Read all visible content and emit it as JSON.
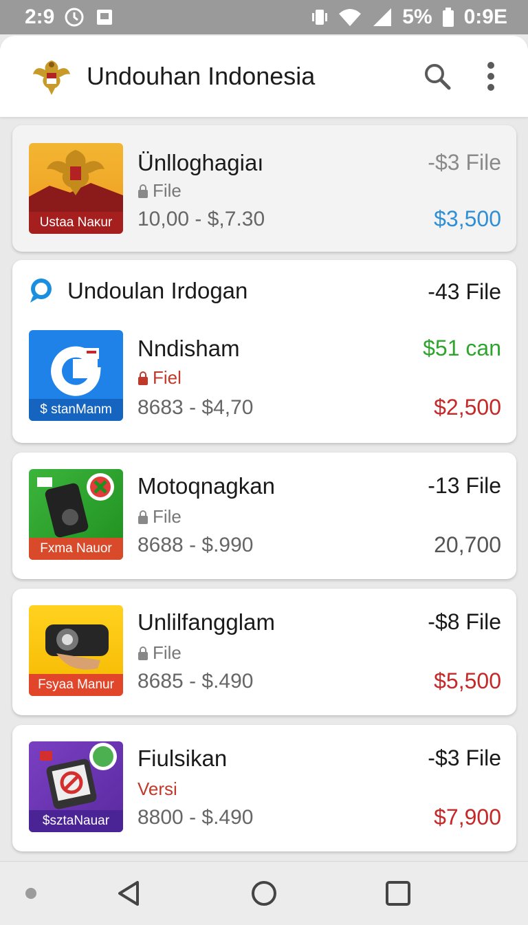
{
  "status_bar": {
    "time": "2:9",
    "battery": "5%",
    "clock_right": "0:9E"
  },
  "app_bar": {
    "title": "Undouhan Indonesia",
    "icons": [
      "garuda-logo",
      "search-icon",
      "more-vert-icon"
    ]
  },
  "items": [
    {
      "name": "Ünlloghagiaı",
      "sub": "File",
      "range": "10,00 - $,7.30",
      "count": "-$3 File",
      "price": "$3,500",
      "thumb_label": "Ustaa Naĸur",
      "price_color": "#2e8fd6"
    }
  ],
  "section": {
    "title": "Undoulan Irdogan",
    "count": "-43 File",
    "item": {
      "name": "Nndisham",
      "sub": "Fiel",
      "range": "8683 - $4,70",
      "price_top": "$51 can",
      "price": "$2,500",
      "thumb_label": "$ stanManm"
    }
  },
  "more_items": [
    {
      "name": "Motoqnagkan",
      "sub": "File",
      "range": "8688 - $.990",
      "count": "-13 File",
      "price": "20,700",
      "thumb_label": "Fxma Nauor"
    },
    {
      "name": "Unlilfangglam",
      "sub": "File",
      "range": "8685 - $.490",
      "count": "-$8 File",
      "price": "$5,500",
      "thumb_label": "Fsyaa Manur"
    },
    {
      "name": "Fiulsikan",
      "sub": "Versi",
      "range": "8800 - $.490",
      "count": "-$3 File",
      "price": "$7,900",
      "thumb_label": "$sztaNauar"
    }
  ],
  "nav_bar": {
    "icons": [
      "back-icon",
      "home-icon",
      "recents-icon"
    ]
  }
}
